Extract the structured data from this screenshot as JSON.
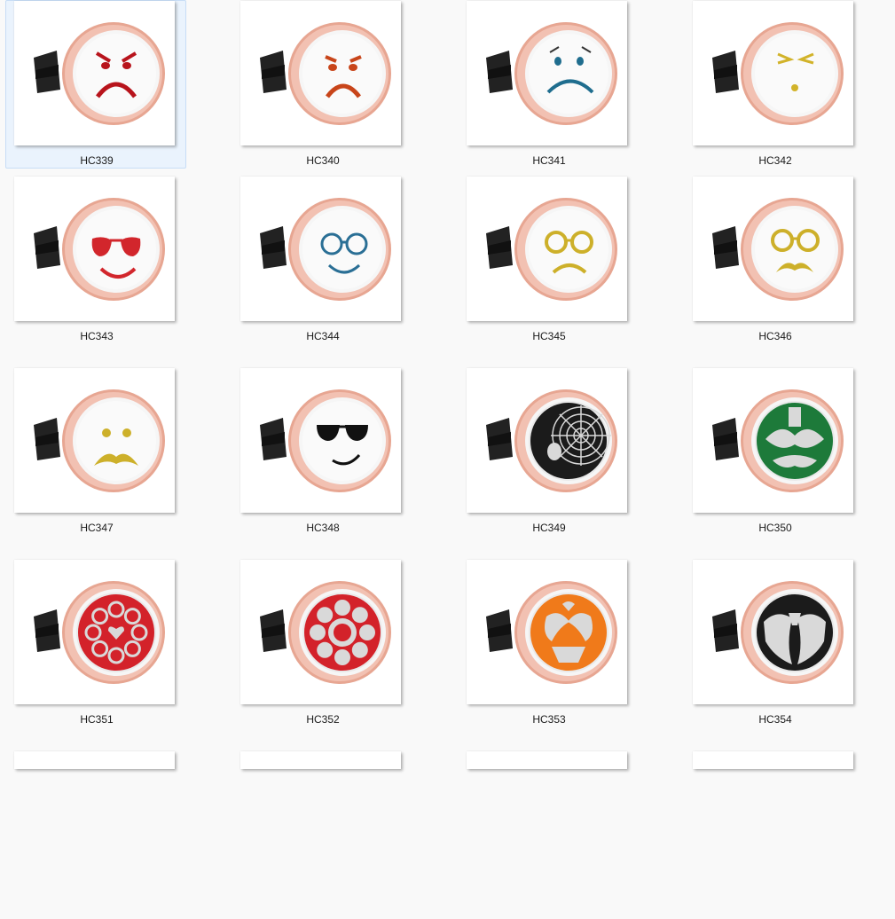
{
  "grid": {
    "items": [
      {
        "label": "HC339",
        "face": "angry",
        "color": "#b8141c",
        "bg": "#ffffff",
        "selected": true
      },
      {
        "label": "HC340",
        "face": "worried",
        "color": "#c8451a",
        "bg": "#ffffff",
        "selected": false
      },
      {
        "label": "HC341",
        "face": "sad",
        "color": "#1f6d8e",
        "bg": "#ffffff",
        "selected": false
      },
      {
        "label": "HC342",
        "face": "squint",
        "color": "#d2b32a",
        "bg": "#ffffff",
        "selected": false
      },
      {
        "label": "HC343",
        "face": "aviator",
        "color": "#d2262c",
        "bg": "#ffffff",
        "selected": false
      },
      {
        "label": "HC344",
        "face": "glasses-smile",
        "color": "#2a6f95",
        "bg": "#ffffff",
        "selected": false
      },
      {
        "label": "HC345",
        "face": "glasses-frown",
        "color": "#cdb02a",
        "bg": "#ffffff",
        "selected": false
      },
      {
        "label": "HC346",
        "face": "glasses-mustache",
        "color": "#cdb02a",
        "bg": "#ffffff",
        "selected": false
      },
      {
        "label": "HC347",
        "face": "mustache",
        "color": "#cdb02a",
        "bg": "#ffffff",
        "selected": false
      },
      {
        "label": "HC348",
        "face": "sunglasses",
        "color": "#111111",
        "bg": "#ffffff",
        "selected": false
      },
      {
        "label": "HC349",
        "face": "spiderweb",
        "color": "#1b1b1b",
        "bg": "#1b1b1b",
        "selected": false
      },
      {
        "label": "HC350",
        "face": "ornate",
        "color": "#1d7a3a",
        "bg": "#1d7a3a",
        "selected": false
      },
      {
        "label": "HC351",
        "face": "hearts-ornate",
        "color": "#d3222a",
        "bg": "#d3222a",
        "selected": false
      },
      {
        "label": "HC352",
        "face": "flower",
        "color": "#d3222a",
        "bg": "#d3222a",
        "selected": false
      },
      {
        "label": "HC353",
        "face": "bears",
        "color": "#f07a1a",
        "bg": "#f07a1a",
        "selected": false
      },
      {
        "label": "HC354",
        "face": "wings",
        "color": "#1b1b1b",
        "bg": "#1b1b1b",
        "selected": false
      }
    ],
    "partial_row_count": 4
  }
}
